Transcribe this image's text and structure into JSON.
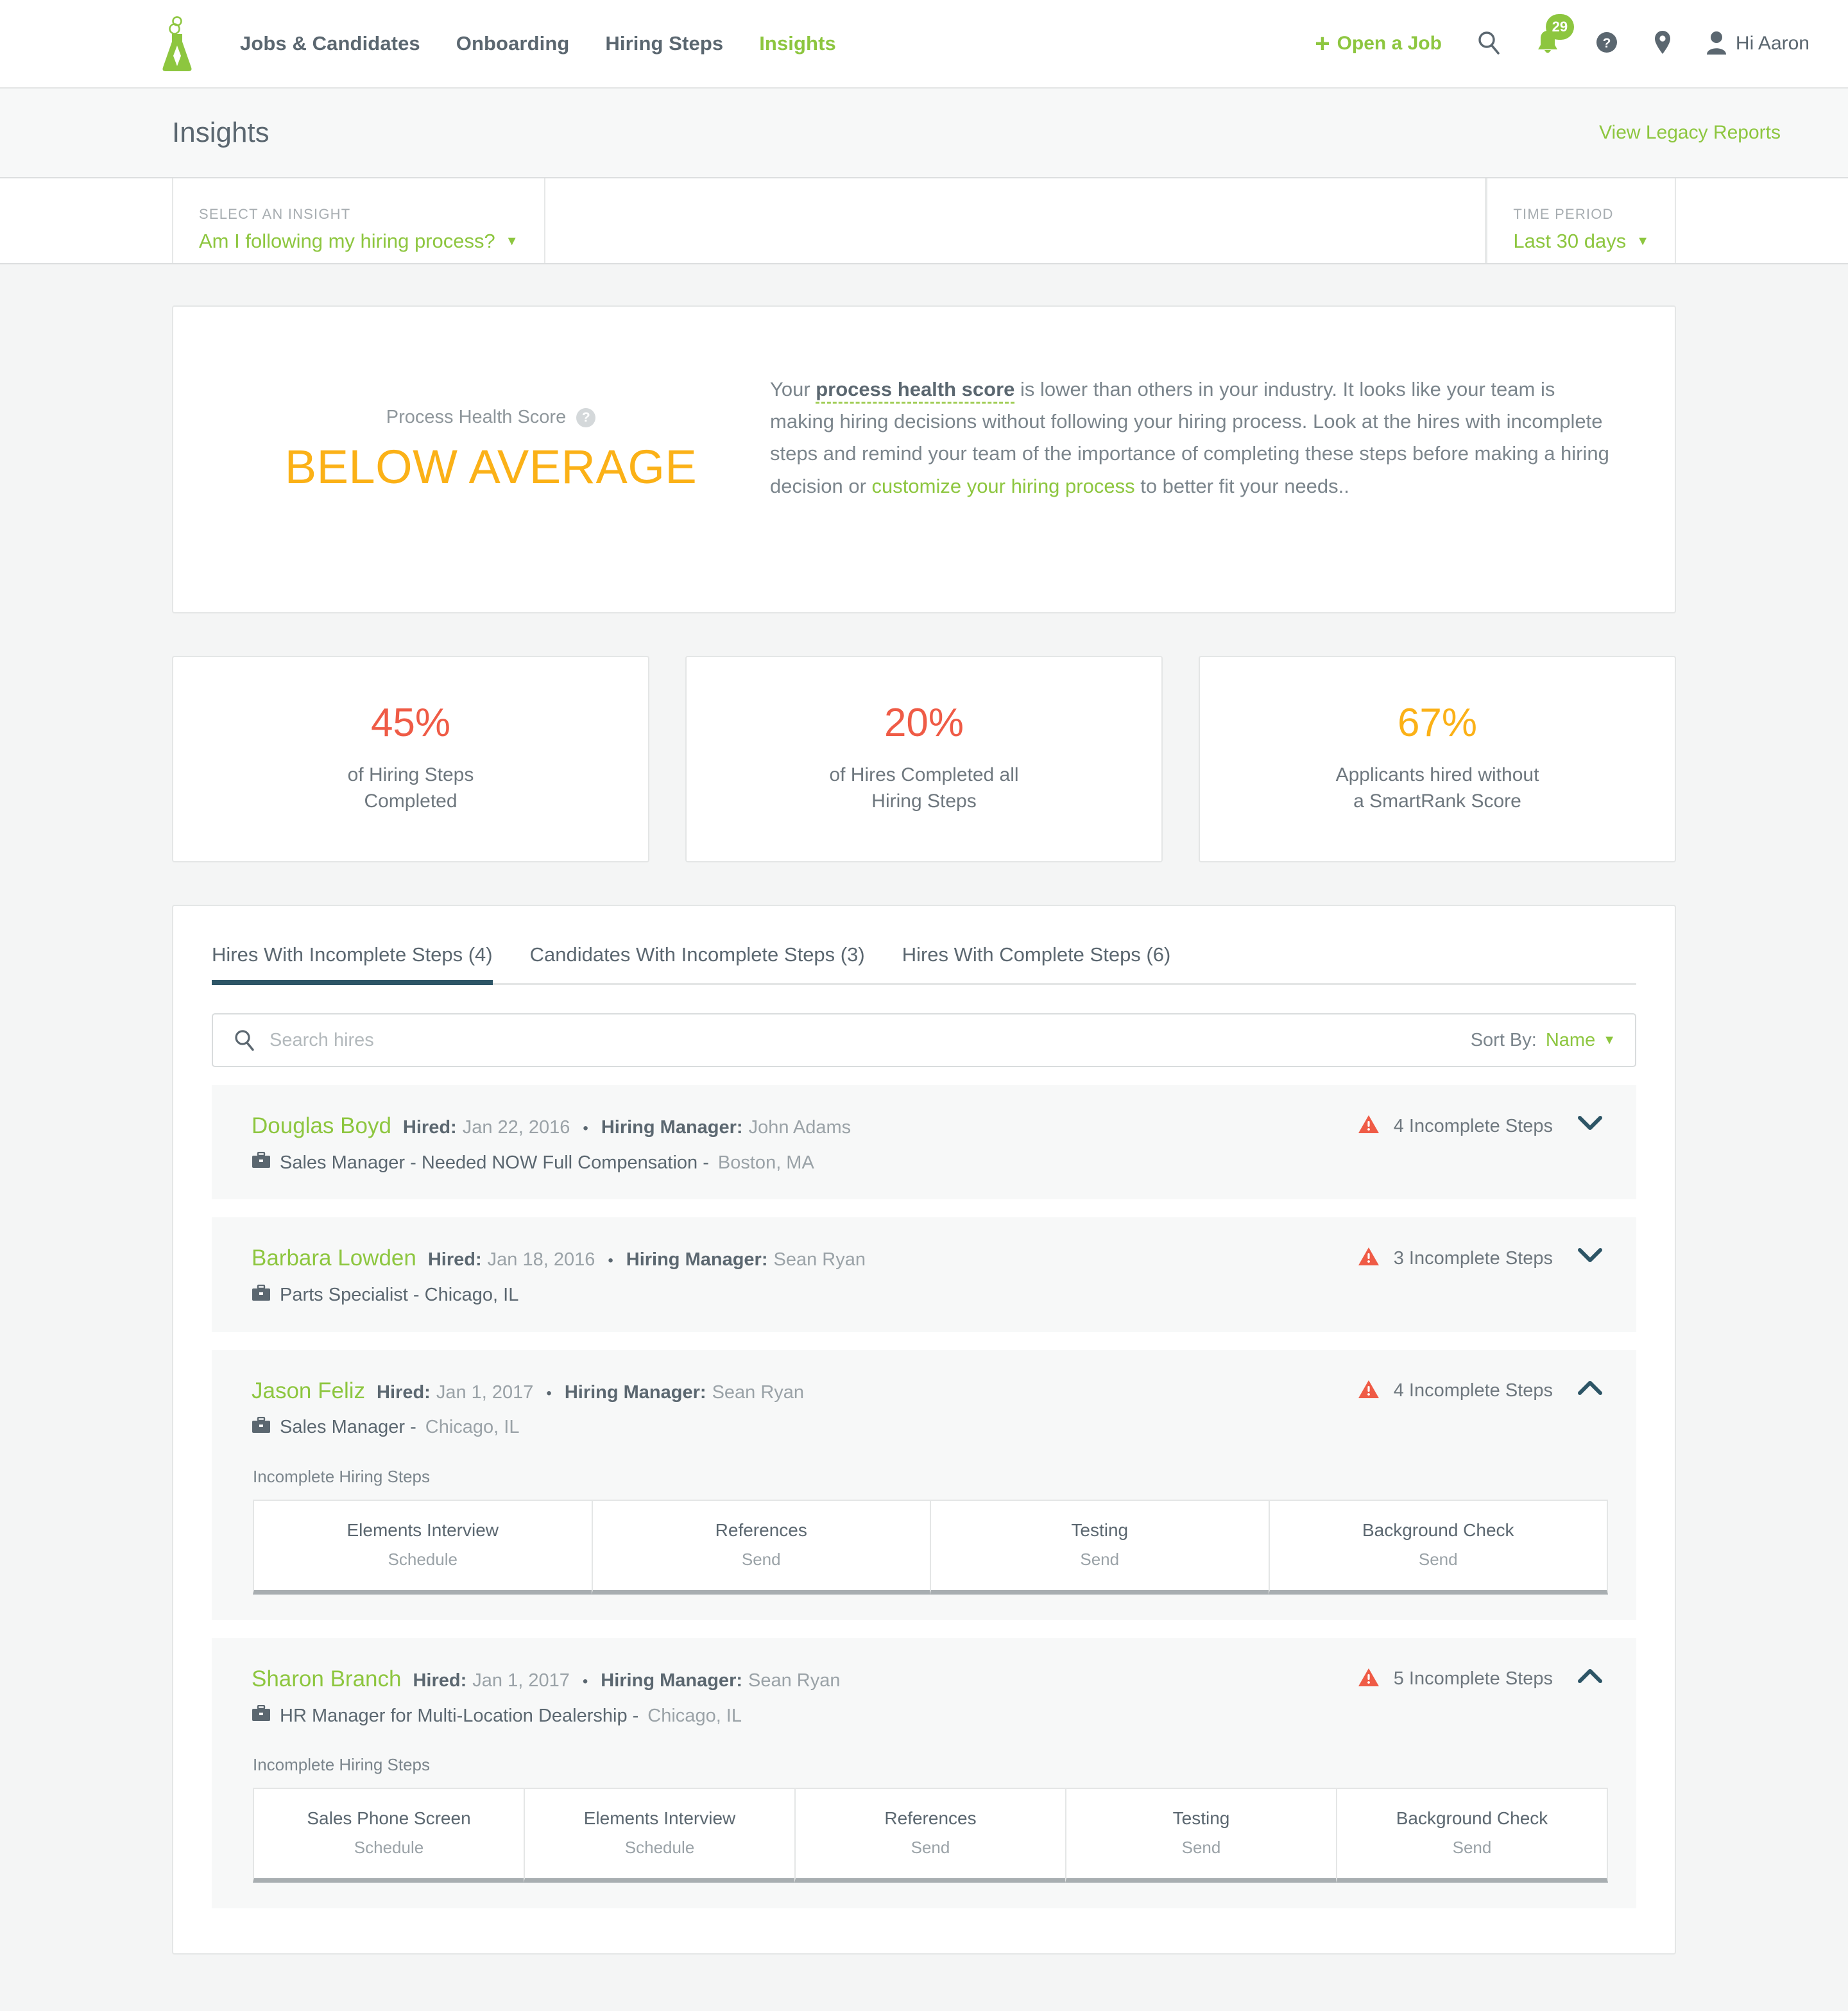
{
  "nav": {
    "logo_name": "smartrecruiters-flask-logo",
    "links": [
      {
        "label": "Jobs & Candidates",
        "active": false
      },
      {
        "label": "Onboarding",
        "active": false
      },
      {
        "label": "Hiring Steps",
        "active": false
      },
      {
        "label": "Insights",
        "active": true
      }
    ],
    "open_job_label": "Open a Job",
    "notification_count": "29",
    "user_greeting": "Hi Aaron"
  },
  "page": {
    "title": "Insights",
    "legacy_reports_link": "View Legacy Reports"
  },
  "filters": {
    "insight": {
      "label": "SELECT AN INSIGHT",
      "value": "Am I following my hiring process?"
    },
    "time_period": {
      "label": "TIME PERIOD",
      "value": "Last 30 days"
    }
  },
  "health": {
    "score_label": "Process Health Score",
    "score_value": "BELOW AVERAGE",
    "score_color": "#fbb117",
    "description": {
      "part1": "Your ",
      "emph": "process health score",
      "part2": " is lower than others in your industry. It looks like your team is making hiring decisions without following your hiring process. Look at the hires with incomplete steps and remind your team of the importance of completing these steps before making a hiring decision or ",
      "link": "customize your hiring process",
      "part3": " to better fit your needs.."
    }
  },
  "stats": [
    {
      "value": "45%",
      "color": "#ef5b46",
      "caption_line1": "of Hiring Steps",
      "caption_line2": "Completed"
    },
    {
      "value": "20%",
      "color": "#ef5b46",
      "caption_line1": "of Hires Completed all",
      "caption_line2": "Hiring Steps"
    },
    {
      "value": "67%",
      "color": "#fbb117",
      "caption_line1": "Applicants hired without",
      "caption_line2": "a SmartRank Score"
    }
  ],
  "tabs": [
    {
      "label": "Hires With Incomplete Steps (4)",
      "active": true
    },
    {
      "label": "Candidates With Incomplete Steps (3)",
      "active": false
    },
    {
      "label": "Hires With Complete Steps (6)",
      "active": false
    }
  ],
  "search": {
    "placeholder": "Search hires",
    "value": "",
    "sort_label": "Sort By:",
    "sort_value": "Name"
  },
  "labels": {
    "hired_key": "Hired:",
    "manager_key": "Hiring Manager:",
    "separator": "•",
    "incomplete_steps_heading": "Incomplete Hiring Steps"
  },
  "hires": [
    {
      "name": "Douglas Boyd",
      "hired_date": "Jan 22, 2016",
      "manager": "John Adams",
      "job_title": "Sales Manager - Needed NOW Full Compensation -",
      "location": "Boston, MA",
      "status": "4 Incomplete Steps",
      "expanded": false,
      "steps": []
    },
    {
      "name": "Barbara Lowden",
      "hired_date": "Jan 18, 2016",
      "manager": "Sean Ryan",
      "job_title": "Parts Specialist - Chicago, IL",
      "location": "",
      "status": "3 Incomplete Steps",
      "expanded": false,
      "steps": []
    },
    {
      "name": "Jason Feliz",
      "hired_date": "Jan 1, 2017",
      "manager": "Sean Ryan",
      "job_title": "Sales Manager -",
      "location": "Chicago, IL",
      "status": "4 Incomplete Steps",
      "expanded": true,
      "steps": [
        {
          "name": "Elements Interview",
          "action": "Schedule"
        },
        {
          "name": "References",
          "action": "Send"
        },
        {
          "name": "Testing",
          "action": "Send"
        },
        {
          "name": "Background Check",
          "action": "Send"
        }
      ]
    },
    {
      "name": "Sharon Branch",
      "hired_date": "Jan 1, 2017",
      "manager": "Sean Ryan",
      "job_title": "HR Manager for Multi-Location Dealership -",
      "location": "Chicago, IL",
      "status": "5 Incomplete Steps",
      "expanded": true,
      "steps": [
        {
          "name": "Sales Phone Screen",
          "action": "Schedule"
        },
        {
          "name": "Elements Interview",
          "action": "Schedule"
        },
        {
          "name": "References",
          "action": "Send"
        },
        {
          "name": "Testing",
          "action": "Send"
        },
        {
          "name": "Background Check",
          "action": "Send"
        }
      ]
    }
  ]
}
